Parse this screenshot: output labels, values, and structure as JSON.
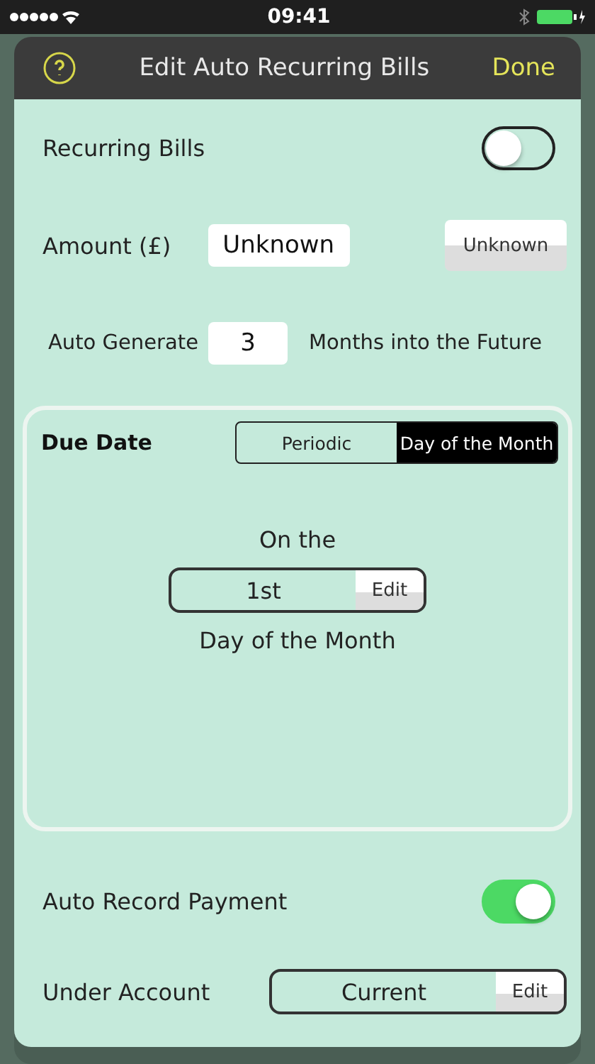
{
  "status_bar": {
    "time": "09:41"
  },
  "header": {
    "title": "Edit Auto Recurring Bills",
    "done": "Done"
  },
  "recurring": {
    "label": "Recurring Bills",
    "on": false
  },
  "amount": {
    "label": "Amount (£)",
    "value": "Unknown",
    "button": "Unknown"
  },
  "auto_generate": {
    "label": "Auto Generate",
    "value": "3",
    "suffix": "Months into the Future"
  },
  "due_date": {
    "title": "Due Date",
    "segments": [
      {
        "label": "Periodic",
        "selected": false
      },
      {
        "label": "Day of the Month",
        "selected": true
      }
    ],
    "prefix": "On the",
    "day": "1st",
    "edit": "Edit",
    "caption": "Day of the Month"
  },
  "auto_record": {
    "label": "Auto Record Payment",
    "on": true
  },
  "under_account": {
    "label": "Under Account",
    "value": "Current",
    "edit": "Edit"
  }
}
